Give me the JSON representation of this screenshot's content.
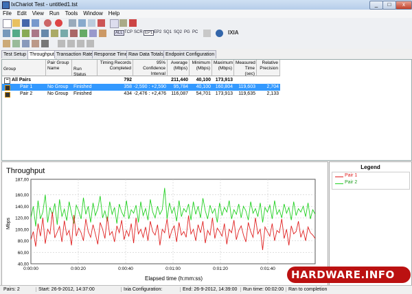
{
  "window": {
    "title": "IxChariot Test - untitled1.tst",
    "min": "_",
    "max": "□",
    "close": "x"
  },
  "menu": [
    "File",
    "Edit",
    "View",
    "Run",
    "Tools",
    "Window",
    "Help"
  ],
  "toolbar2": {
    "all": "ALL",
    "tcp": "TCP",
    "scr": "SCR",
    "ep1": "EP1",
    "ep2": "EP2",
    "sq1": "SQ1",
    "sq2": "SQ2",
    "pg": "PG",
    "pc": "PC",
    "ixia": "IXIA"
  },
  "tabs": [
    "Test Setup",
    "Throughput",
    "Transaction Rate",
    "Response Time",
    "Raw Data Totals",
    "Endpoint Configuration"
  ],
  "table": {
    "headers": [
      "Group",
      "Pair Group Name",
      "Run Status",
      "Timing Records Completed",
      "95% Confidence Interval",
      "Average (Mbps)",
      "Minimum (Mbps)",
      "Maximum (Mbps)",
      "Measured Time (sec)",
      "Relative Precision"
    ],
    "all": {
      "label": "All Pairs",
      "records": "792",
      "average": "211,440",
      "minimum": "40,100",
      "maximum": "173,913"
    },
    "rows": [
      {
        "pair": "Pair 1",
        "group": "No Group",
        "status": "Finished",
        "records": "358",
        "ci": "-2,590 : +2,590",
        "avg": "95,784",
        "min": "40,100",
        "max": "160,804",
        "time": "119,603",
        "prec": "2,704"
      },
      {
        "pair": "Pair 2",
        "group": "No Group",
        "status": "Finished",
        "records": "434",
        "ci": "-2,476 : +2,476",
        "avg": "116,087",
        "min": "54,701",
        "max": "173,913",
        "time": "119,635",
        "prec": "2,133"
      }
    ]
  },
  "legend": {
    "title": "Legend",
    "items": [
      "Pair 1",
      "Pair 2"
    ]
  },
  "status": {
    "pairs": "Pairs: 2",
    "start": "Start: 26-9-2012, 14:37:00",
    "ixia": "Ixia Configuration:",
    "end": "End: 26-9-2012, 14:39:00",
    "run": "Run time: 00:02:00",
    "ran": "Ran to completion"
  },
  "watermark": "HARDWARE.INFO",
  "colors": {
    "pair1": "#e02020",
    "pair2": "#20d020",
    "selected": "#3399ff"
  },
  "chart_data": {
    "type": "line",
    "title": "Throughput",
    "xlabel": "Elapsed time (h:mm:ss)",
    "ylabel": "Mbps",
    "ylim": [
      40,
      187
    ],
    "yticks": [
      "40,00",
      "60,00",
      "80,00",
      "100,00",
      "120,00",
      "140,00",
      "160,00",
      "187,00"
    ],
    "xticks": [
      "0:00:00",
      "0:00:20",
      "0:00:40",
      "0:01:00",
      "0:01:20",
      "0:01:40",
      "0:02:00"
    ],
    "xlim": [
      0,
      120
    ],
    "series": [
      {
        "name": "Pair 1",
        "values": [
          82,
          96,
          70,
          110,
          88,
          120,
          75,
          100,
          92,
          130,
          85,
          95,
          105,
          78,
          115,
          90,
          98,
          72,
          125,
          88,
          102,
          94,
          80,
          118,
          96,
          86,
          108,
          92,
          74,
          112,
          100,
          84,
          122,
          90,
          96,
          78,
          106,
          94,
          116,
          82,
          98,
          88,
          110,
          76,
          120,
          92,
          100,
          86,
          104,
          80,
          114,
          96,
          90,
          108,
          72,
          100,
          94,
          118,
          84,
          98,
          106,
          78,
          112,
          90,
          96,
          86,
          124,
          92,
          100,
          80,
          108,
          94,
          114,
          76,
          98,
          90,
          120,
          84,
          102,
          96,
          88,
          110,
          74,
          100,
          94,
          116,
          82,
          98,
          106,
          90,
          78,
          112,
          96,
          86,
          120,
          92,
          100,
          64,
          104,
          96,
          88,
          110,
          80,
          98,
          94,
          118,
          84,
          100,
          72,
          106,
          92,
          96,
          114,
          86,
          98,
          80,
          104,
          94,
          90,
          84
        ]
      },
      {
        "name": "Pair 2",
        "values": [
          120,
          140,
          105,
          150,
          118,
          130,
          160,
          112,
          138,
          125,
          145,
          108,
          152,
          122,
          135,
          115,
          148,
          128,
          110,
          142,
          132,
          118,
          155,
          126,
          140,
          112,
          146,
          124,
          136,
          158,
          120,
          132,
          114,
          148,
          126,
          138,
          110,
          144,
          130,
          122,
          150,
          118,
          134,
          128,
          142,
          112,
          148,
          124,
          136,
          116,
          152,
          130,
          120,
          140,
          126,
          134,
          172,
          118,
          146,
          128,
          138,
          114,
          150,
          122,
          136,
          130,
          144,
          116,
          148,
          126,
          140,
          120,
          154,
          132,
          118,
          142,
          128,
          136,
          112,
          146,
          124,
          138,
          130,
          150,
          118,
          134,
          126,
          144,
          120,
          140,
          132,
          116,
          148,
          128,
          136,
          122,
          146,
          112,
          138,
          130,
          142,
          118,
          150,
          126,
          134,
          120,
          144,
          128,
          138,
          116,
          148,
          124,
          136,
          130,
          140,
          122,
          146,
          118,
          134,
          126
        ]
      }
    ]
  }
}
